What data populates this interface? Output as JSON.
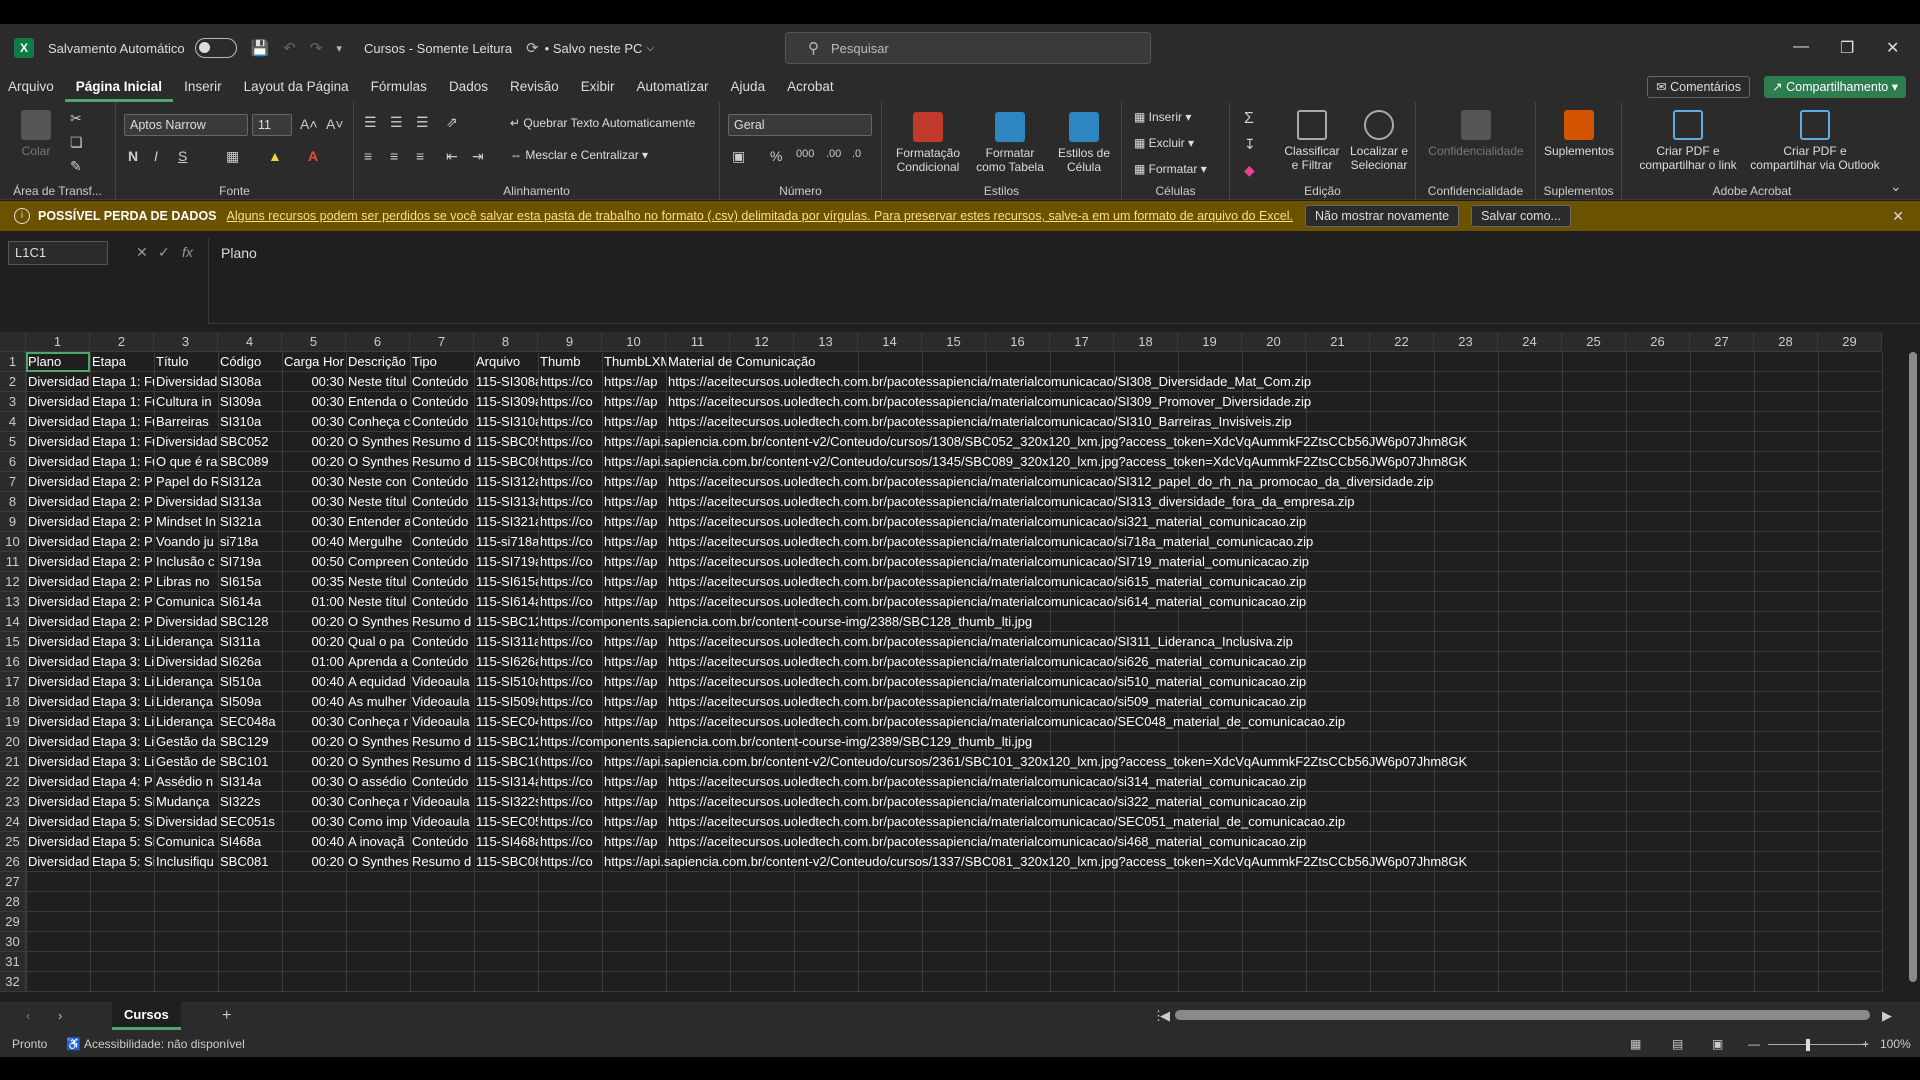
{
  "titlebar": {
    "autosave_label": "Salvamento Automático",
    "doc_title": "Cursos  -  Somente Leitura",
    "save_status": "• Salvo neste PC",
    "search_placeholder": "Pesquisar"
  },
  "menu": {
    "items": [
      "Arquivo",
      "Página Inicial",
      "Inserir",
      "Layout da Página",
      "Fórmulas",
      "Dados",
      "Revisão",
      "Exibir",
      "Automatizar",
      "Ajuda",
      "Acrobat"
    ],
    "active": "Página Inicial",
    "comments": "Comentários",
    "share": "Compartilhamento"
  },
  "ribbon": {
    "clipboard": {
      "paste": "Colar",
      "label": "Área de Transf..."
    },
    "font": {
      "name": "Aptos Narrow",
      "size": "11",
      "label": "Fonte",
      "bold": "N",
      "italic": "I",
      "underline": "S"
    },
    "alignment": {
      "wrap": "Quebrar Texto Automaticamente",
      "merge": "Mesclar e Centralizar",
      "label": "Alinhamento"
    },
    "number": {
      "format": "Geral",
      "label": "Número"
    },
    "styles": {
      "cond": "Formatação Condicional",
      "table": "Formatar como Tabela",
      "cell": "Estilos de Célula",
      "label": "Estilos"
    },
    "cells": {
      "insert": "Inserir",
      "delete": "Excluir",
      "format": "Formatar",
      "label": "Células"
    },
    "editing": {
      "sort": "Classificar e Filtrar",
      "find": "Localizar e Selecionar",
      "label": "Edição"
    },
    "sensitivity": {
      "btn": "Confidencialidade",
      "label": "Confidencialidade"
    },
    "addins": {
      "btn": "Suplementos",
      "label": "Suplementos"
    },
    "acrobat": {
      "pdf_link": "Criar PDF e compartilhar o link",
      "pdf_outlook": "Criar PDF e compartilhar via Outlook",
      "label": "Adobe Acrobat"
    }
  },
  "warning": {
    "title": "POSSÍVEL PERDA DE DADOS",
    "message": "Alguns recursos podem ser perdidos se você salvar esta pasta de trabalho no formato (.csv) delimitada por vírgulas. Para preservar estes recursos, salve-a em um formato de arquivo do Excel.",
    "btn_dismiss": "Não mostrar novamente",
    "btn_save": "Salvar como..."
  },
  "formula": {
    "namebox": "L1C1",
    "fx": "fx",
    "content": "Plano"
  },
  "columns": [
    "1",
    "2",
    "3",
    "4",
    "5",
    "6",
    "7",
    "8",
    "9",
    "10",
    "11",
    "12",
    "13",
    "14",
    "15",
    "16",
    "17",
    "18",
    "19",
    "20",
    "21",
    "22",
    "23",
    "24",
    "25",
    "26",
    "27",
    "28",
    "29"
  ],
  "rows": [
    [
      "Plano",
      "Etapa",
      "Título",
      "Código",
      "Carga Hor",
      "Descrição",
      "Tipo",
      "Arquivo",
      "Thumb",
      "ThumbLXM",
      "Material de Comunicação"
    ],
    [
      "Diversidad",
      "Etapa 1: Fu",
      "Diversidad",
      "SI308a",
      "00:30",
      "Neste títul",
      "Conteúdo",
      "115-SI308a",
      "https://co",
      "https://ap",
      "https://aceitecursos.uoledtech.com.br/pacotessapiencia/materialcomunicacao/SI308_Diversidade_Mat_Com.zip"
    ],
    [
      "Diversidad",
      "Etapa 1: Fu",
      "Cultura in",
      "SI309a",
      "00:30",
      "Entenda o",
      "Conteúdo",
      "115-SI309a",
      "https://co",
      "https://ap",
      "https://aceitecursos.uoledtech.com.br/pacotessapiencia/materialcomunicacao/SI309_Promover_Diversidade.zip"
    ],
    [
      "Diversidad",
      "Etapa 1: Fu",
      "Barreiras",
      "SI310a",
      "00:30",
      "Conheça c",
      "Conteúdo",
      "115-SI310a",
      "https://co",
      "https://ap",
      "https://aceitecursos.uoledtech.com.br/pacotessapiencia/materialcomunicacao/SI310_Barreiras_Invisiveis.zip"
    ],
    [
      "Diversidad",
      "Etapa 1: Fu",
      "Diversidad",
      "SBC052",
      "00:20",
      "O Synthes",
      "Resumo d",
      "115-SBC05",
      "https://co",
      "https://api.sapiencia.com.br/content-v2/Conteudo/cursos/1308/SBC052_320x120_lxm.jpg?access_token=XdcVqAummkF2ZtsCCb56JW6p07Jhm8GK",
      ""
    ],
    [
      "Diversidad",
      "Etapa 1: Fu",
      "O que é ra",
      "SBC089",
      "00:20",
      "O Synthes",
      "Resumo d",
      "115-SBC08",
      "https://co",
      "https://api.sapiencia.com.br/content-v2/Conteudo/cursos/1345/SBC089_320x120_lxm.jpg?access_token=XdcVqAummkF2ZtsCCb56JW6p07Jhm8GK",
      ""
    ],
    [
      "Diversidad",
      "Etapa 2: P",
      "Papel do R",
      "SI312a",
      "00:30",
      "Neste con",
      "Conteúdo",
      "115-SI312a",
      "https://co",
      "https://ap",
      "https://aceitecursos.uoledtech.com.br/pacotessapiencia/materialcomunicacao/SI312_papel_do_rh_na_promocao_da_diversidade.zip"
    ],
    [
      "Diversidad",
      "Etapa 2: P",
      "Diversidad",
      "SI313a",
      "00:30",
      "Neste títul",
      "Conteúdo",
      "115-SI313a",
      "https://co",
      "https://ap",
      "https://aceitecursos.uoledtech.com.br/pacotessapiencia/materialcomunicacao/SI313_diversidade_fora_da_empresa.zip"
    ],
    [
      "Diversidad",
      "Etapa 2: P",
      "Mindset In",
      "SI321a",
      "00:30",
      "Entender a",
      "Conteúdo",
      "115-SI321a",
      "https://co",
      "https://ap",
      "https://aceitecursos.uoledtech.com.br/pacotessapiencia/materialcomunicacao/si321_material_comunicacao.zip"
    ],
    [
      "Diversidad",
      "Etapa 2: P",
      "Voando ju",
      "si718a",
      "00:40",
      "Mergulhe",
      "Conteúdo",
      "115-si718a",
      "https://co",
      "https://ap",
      "https://aceitecursos.uoledtech.com.br/pacotessapiencia/materialcomunicacao/si718a_material_comunicacao.zip"
    ],
    [
      "Diversidad",
      "Etapa 2: P",
      "Inclusão c",
      "SI719a",
      "00:50",
      "Comprеen",
      "Conteúdo",
      "115-SI719a",
      "https://co",
      "https://ap",
      "https://aceitecursos.uoledtech.com.br/pacotessapiencia/materialcomunicacao/SI719_material_comunicacao.zip"
    ],
    [
      "Diversidad",
      "Etapa 2: P",
      "Libras no",
      "SI615a",
      "00:35",
      "Neste títul",
      "Conteúdo",
      "115-SI615a",
      "https://co",
      "https://ap",
      "https://aceitecursos.uoledtech.com.br/pacotessapiencia/materialcomunicacao/si615_material_comunicacao.zip"
    ],
    [
      "Diversidad",
      "Etapa 2: P",
      "Comunica",
      "SI614a",
      "01:00",
      "Neste títul",
      "Conteúdo",
      "115-SI614a",
      "https://co",
      "https://ap",
      "https://aceitecursos.uoledtech.com.br/pacotessapiencia/materialcomunicacao/si614_material_comunicacao.zip"
    ],
    [
      "Diversidad",
      "Etapa 2: P",
      "Diversidad",
      "SBC128",
      "00:20",
      "O Synthes",
      "Resumo d",
      "115-SBC12",
      "https://components.sapiencia.com.br/content-course-img/2388/SBC128_thumb_lti.jpg",
      "",
      ""
    ],
    [
      "Diversidad",
      "Etapa 3: Li",
      "Liderança",
      "SI311a",
      "00:20",
      "Qual o pa",
      "Conteúdo",
      "115-SI311a",
      "https://co",
      "https://ap",
      "https://aceitecursos.uoledtech.com.br/pacotessapiencia/materialcomunicacao/SI311_Lideranca_Inclusiva.zip"
    ],
    [
      "Diversidad",
      "Etapa 3: Li",
      "Diversidad",
      "SI626a",
      "01:00",
      "Aprenda a",
      "Conteúdo",
      "115-SI626a",
      "https://co",
      "https://ap",
      "https://aceitecursos.uoledtech.com.br/pacotessapiencia/materialcomunicacao/si626_material_comunicacao.zip"
    ],
    [
      "Diversidad",
      "Etapa 3: Li",
      "Liderança",
      "SI510a",
      "00:40",
      "A equidad",
      "Videoaula",
      "115-SI510a",
      "https://co",
      "https://ap",
      "https://aceitecursos.uoledtech.com.br/pacotessapiencia/materialcomunicacao/si510_material_comunicacao.zip"
    ],
    [
      "Diversidad",
      "Etapa 3: Li",
      "Liderança",
      "SI509a",
      "00:40",
      "As mulher",
      "Videoaula",
      "115-SI509a",
      "https://co",
      "https://ap",
      "https://aceitecursos.uoledtech.com.br/pacotessapiencia/materialcomunicacao/si509_material_comunicacao.zip"
    ],
    [
      "Diversidad",
      "Etapa 3: Li",
      "Liderança",
      "SEC048a",
      "00:30",
      "Conheça r",
      "Videoaula",
      "115-SEC04",
      "https://co",
      "https://ap",
      "https://aceitecursos.uoledtech.com.br/pacotessapiencia/materialcomunicacao/SEC048_material_de_comunicacao.zip"
    ],
    [
      "Diversidad",
      "Etapa 3: Li",
      "Gestão da",
      "SBC129",
      "00:20",
      "O Synthes",
      "Resumo d",
      "115-SBC12",
      "https://components.sapiencia.com.br/content-course-img/2389/SBC129_thumb_lti.jpg",
      "",
      ""
    ],
    [
      "Diversidad",
      "Etapa 3: Li",
      "Gestão de",
      "SBC101",
      "00:20",
      "O Synthes",
      "Resumo d",
      "115-SBC10",
      "https://co",
      "https://api.sapiencia.com.br/content-v2/Conteudo/cursos/2361/SBC101_320x120_lxm.jpg?access_token=XdcVqAummkF2ZtsCCb56JW6p07Jhm8GK",
      ""
    ],
    [
      "Diversidad",
      "Etapa 4: P",
      "Assédio n",
      "SI314a",
      "00:30",
      "O assédio",
      "Conteúdo",
      "115-SI314a",
      "https://co",
      "https://ap",
      "https://aceitecursos.uoledtech.com.br/pacotessapiencia/materialcomunicacao/si314_material_comunicacao.zip"
    ],
    [
      "Diversidad",
      "Etapa 5: Si",
      "Mudança",
      "SI322s",
      "00:30",
      "Conheça r",
      "Videoaula",
      "115-SI322s",
      "https://co",
      "https://ap",
      "https://aceitecursos.uoledtech.com.br/pacotessapiencia/materialcomunicacao/si322_material_comunicacao.zip"
    ],
    [
      "Diversidad",
      "Etapa 5: Si",
      "Diversidad",
      "SEC051s",
      "00:30",
      "Como imp",
      "Videoaula",
      "115-SEC05",
      "https://co",
      "https://ap",
      "https://aceitecursos.uoledtech.com.br/pacotessapiencia/materialcomunicacao/SEC051_material_de_comunicacao.zip"
    ],
    [
      "Diversidad",
      "Etapa 5: Si",
      "Comunica",
      "SI468a",
      "00:40",
      "A inovaçã",
      "Conteúdo",
      "115-SI468a",
      "https://co",
      "https://ap",
      "https://aceitecursos.uoledtech.com.br/pacotessapiencia/materialcomunicacao/si468_material_comunicacao.zip"
    ],
    [
      "Diversidad",
      "Etapa 5: Si",
      "Inclusifiqu",
      "SBC081",
      "00:20",
      "O Synthes",
      "Resumo d",
      "115-SBC08",
      "https://co",
      "https://api.sapiencia.com.br/content-v2/Conteudo/cursos/1337/SBC081_320x120_lxm.jpg?access_token=XdcVqAummkF2ZtsCCb56JW6p07Jhm8GK",
      ""
    ]
  ],
  "row_numbers": [
    "1",
    "2",
    "3",
    "4",
    "5",
    "6",
    "7",
    "8",
    "9",
    "10",
    "11",
    "12",
    "13",
    "14",
    "15",
    "16",
    "17",
    "18",
    "19",
    "20",
    "21",
    "22",
    "23",
    "24",
    "25",
    "26",
    "27",
    "28",
    "29",
    "30",
    "31",
    "32"
  ],
  "sheet": {
    "tab": "Cursos",
    "add": "+"
  },
  "status": {
    "ready": "Pronto",
    "accessibility": "Acessibilidade: não disponível",
    "zoom": "100%"
  }
}
